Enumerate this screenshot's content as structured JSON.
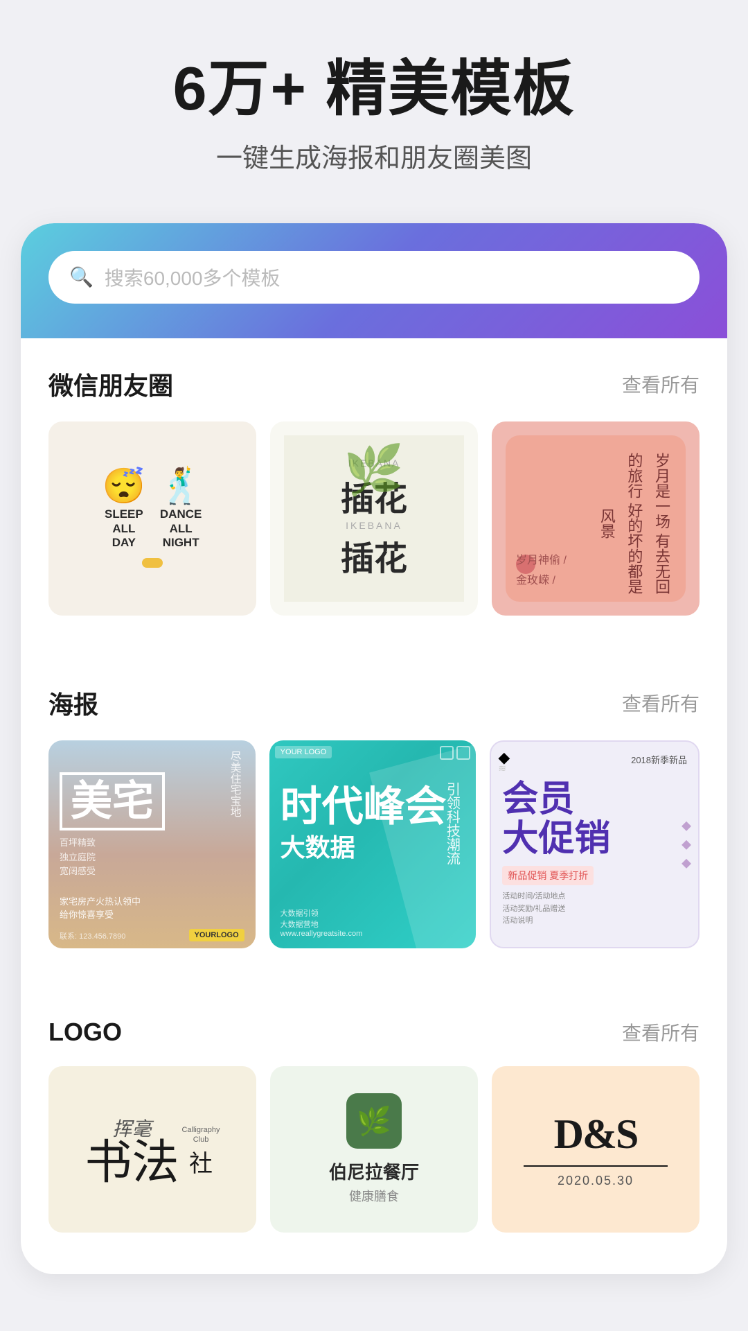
{
  "hero": {
    "title": "6万+ 精美模板",
    "subtitle": "一键生成海报和朋友圈美图"
  },
  "search": {
    "placeholder": "搜索60,000多个模板"
  },
  "sections": {
    "wechat": {
      "title": "微信朋友圈",
      "link": "查看所有",
      "cards": [
        {
          "type": "sleep-dance",
          "sleep_label": "SLEEP ALL DAY",
          "dance_label": "DANCE ALL NIGHT"
        },
        {
          "type": "ikebana",
          "title_en": "IKEBANA",
          "title_cn": "插花"
        },
        {
          "type": "poem",
          "line1": "岁月是一场",
          "line2": "有去无回的旅行",
          "line3": "好的坏的都是风景",
          "author1": "岁月神偷 /",
          "author2": "金玫嵘 /"
        }
      ]
    },
    "poster": {
      "title": "海报",
      "link": "查看所有",
      "cards": [
        {
          "type": "real-estate",
          "title": "美宅",
          "side_text": "尽美 住宅 宝地",
          "bottom_info": "家宅房产火热认领中",
          "logo": "YOURLOGO"
        },
        {
          "type": "big-data",
          "your_logo": "YOUR LOGO",
          "sub1": "引领科技潮流",
          "title": "时代峰会",
          "subtitle": "大数据"
        },
        {
          "type": "member",
          "year": "2018新季新品",
          "title": "会员大促销",
          "sub": "新品促销 夏季打折"
        }
      ]
    },
    "logo": {
      "title": "LOGO",
      "link": "查看所有",
      "cards": [
        {
          "type": "calligraphy",
          "cn_big": "书法",
          "en_name": "Calligraphy Club",
          "cn_sub": "社",
          "brush": "挥毫"
        },
        {
          "type": "restaurant",
          "name": "伯尼拉餐厅",
          "sub": "健康膳食"
        },
        {
          "type": "ds",
          "logo": "D&S",
          "date": "2020.05.30"
        }
      ]
    }
  }
}
